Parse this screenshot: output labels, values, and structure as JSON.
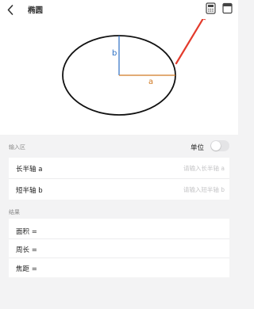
{
  "header": {
    "title": "椭圆",
    "back_icon": "chevron-left-icon",
    "action_icons": [
      "calculator-icon",
      "window-icon"
    ]
  },
  "diagram": {
    "semi_major_label": "a",
    "semi_minor_label": "b",
    "colors": {
      "semi_major": "#d07a24",
      "semi_minor": "#2b6fc4",
      "annotation_arrow": "#e33b2c"
    }
  },
  "input_section": {
    "label": "输入区",
    "unit_label": "单位",
    "unit_toggle_on": false,
    "fields": [
      {
        "label": "长半轴 a",
        "value": "",
        "placeholder": "请输入长半轴 a"
      },
      {
        "label": "短半轴 b",
        "value": "",
        "placeholder": "请输入短半轴 b"
      }
    ]
  },
  "result_section": {
    "label": "结果",
    "rows": [
      {
        "label": "面积 ="
      },
      {
        "label": "周长 ="
      },
      {
        "label": "焦距 ="
      }
    ]
  }
}
